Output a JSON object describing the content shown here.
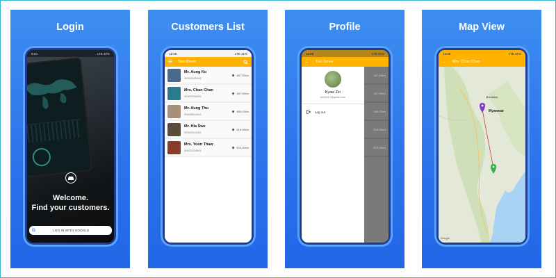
{
  "panels": {
    "login": {
      "heading": "Login"
    },
    "customers": {
      "heading": "Customers List"
    },
    "profile": {
      "heading": "Profile"
    },
    "map": {
      "heading": "Map View"
    }
  },
  "status": {
    "login_time": "6:03",
    "customers_time": "12:09",
    "profile_time": "12:09",
    "map_time": "12:09",
    "signal": "LTE",
    "login_battery": "32%",
    "battery": "31%"
  },
  "login": {
    "welcome": "Welcome.",
    "tagline": "Find your customers.",
    "google_button": "LOG IN WITH GOOGLE",
    "google_logo": "G"
  },
  "app": {
    "title": "Taxi Driver"
  },
  "customers": [
    {
      "name": "Mr. Aung Ko",
      "phone": "09342425345",
      "distance": "487.53km",
      "color": "#4a6a8c"
    },
    {
      "name": "Mrs. Chan Chan",
      "phone": "09342356239",
      "distance": "487.99km",
      "color": "#2a7b8d"
    },
    {
      "name": "Mr. Aung Thu",
      "phone": "09443534542",
      "distance": "489.03km",
      "color": "#a89078"
    },
    {
      "name": "Mr. Hla Swe",
      "phone": "09342343432",
      "distance": "518.06km",
      "color": "#5a4a3c"
    },
    {
      "name": "Mrs. Yoon Thaw",
      "phone": "09423234643",
      "distance": "523.00km",
      "color": "#8a3c28"
    }
  ],
  "profile": {
    "name": "Kyaw Zin",
    "email": "kzin3117@gmail.com",
    "logout": "Log out",
    "peek_distances": [
      "487.53km",
      "487.99km",
      "489.03km",
      "518.06km",
      "523.00km"
    ]
  },
  "map": {
    "title": "Mrs. Chan Chan",
    "city_label": "Mandalay",
    "country_label": "Myanmar",
    "google_mark": "Google"
  },
  "colors": {
    "accent": "#ffb300",
    "panel_blue": "#2e74ec",
    "phone_frame": "#1e3d92"
  },
  "icons": {
    "menu": "hamburger-icon",
    "search": "search-icon",
    "back": "arrow-back-icon",
    "logout": "logout-icon",
    "pin": "location-pin-icon"
  }
}
